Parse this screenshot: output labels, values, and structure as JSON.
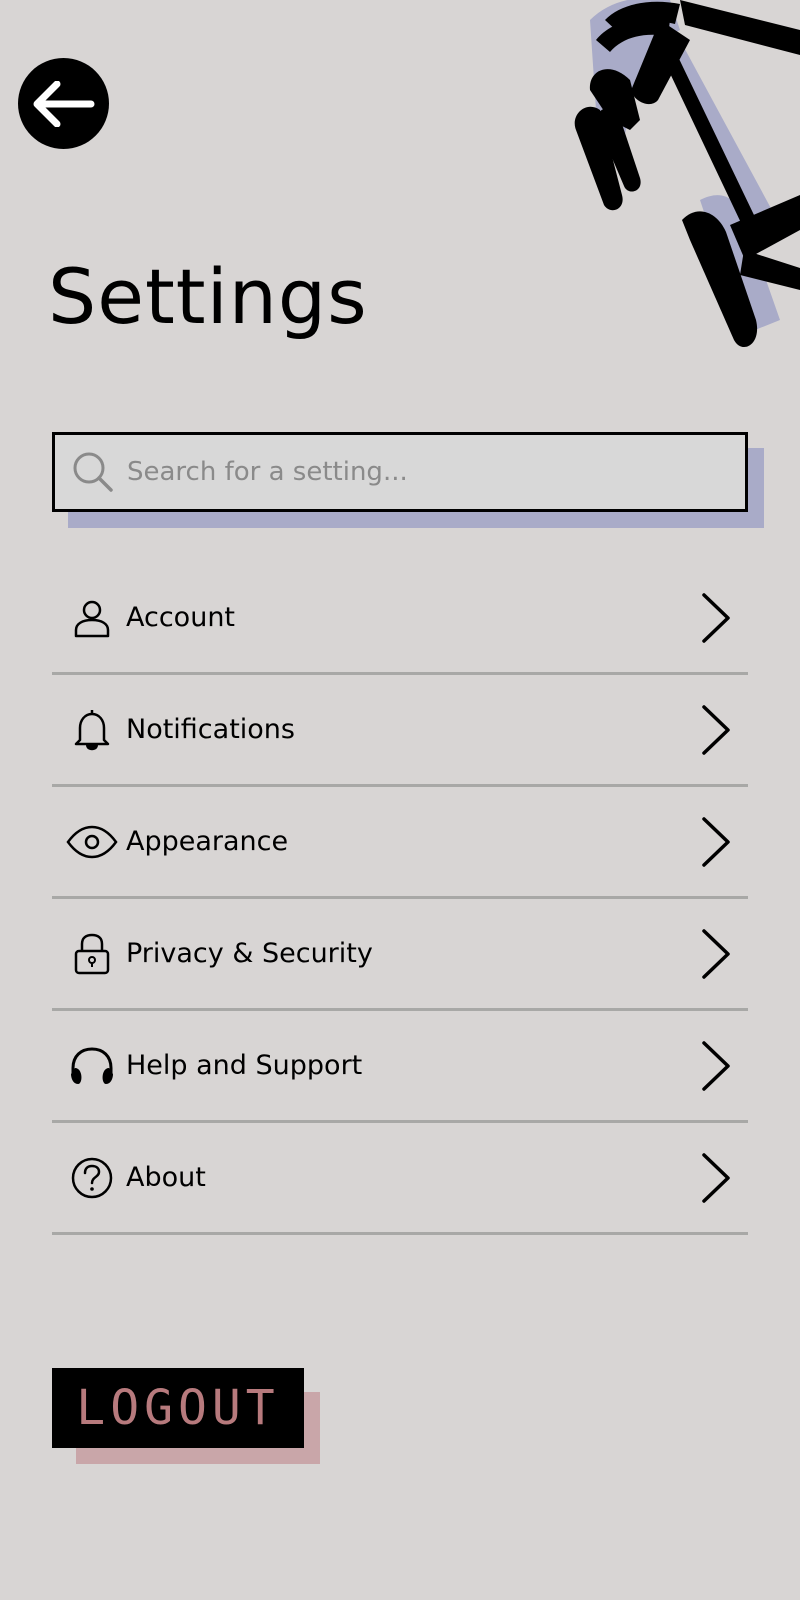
{
  "header": {
    "title": "Settings",
    "back_icon": "arrow-left-icon"
  },
  "search": {
    "placeholder": "Search for a setting...",
    "value": "",
    "icon": "search-icon"
  },
  "menu": {
    "items": [
      {
        "label": "Account",
        "icon": "person-icon"
      },
      {
        "label": "Notifications",
        "icon": "bell-icon"
      },
      {
        "label": "Appearance",
        "icon": "eye-icon"
      },
      {
        "label": "Privacy & Security",
        "icon": "lock-icon"
      },
      {
        "label": "Help and Support",
        "icon": "headphones-icon"
      },
      {
        "label": "About",
        "icon": "question-circle-icon"
      }
    ],
    "chevron_icon": "chevron-right-icon"
  },
  "logout": {
    "label": "LOGOUT"
  },
  "colors": {
    "background": "#d8d5d4",
    "accent_shadow": "#a9abc8",
    "logout_text": "#b77a7d",
    "logout_shadow": "#c9a6a9",
    "divider": "#a8a8a6"
  }
}
